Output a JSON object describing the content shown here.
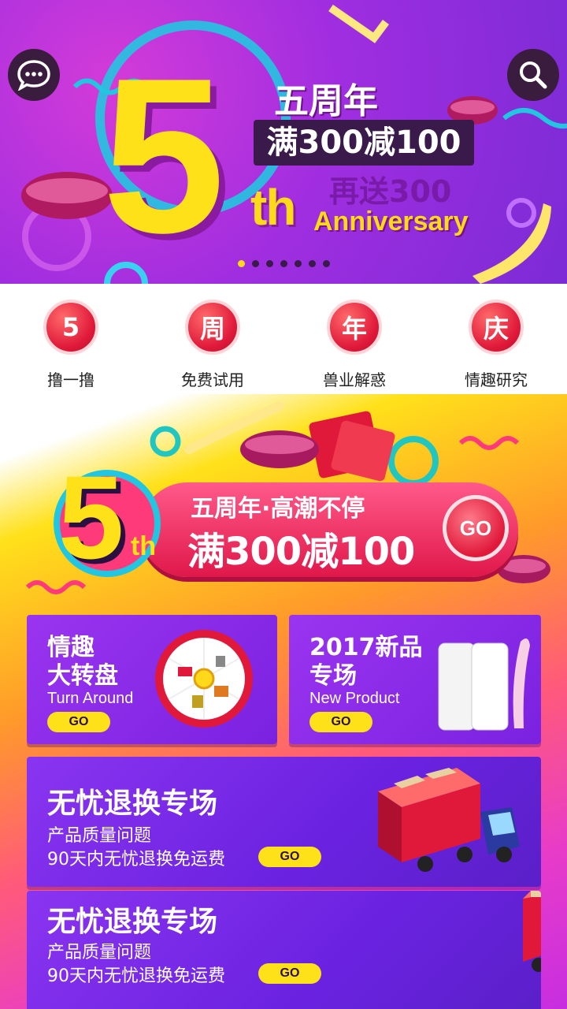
{
  "hero": {
    "big_number": "5",
    "suffix": "th",
    "line1": "五周年",
    "line2": "满300减100",
    "line3": "再送300",
    "line4": "Anniversary",
    "dots_total": 7,
    "dots_active": 0,
    "chat_icon": "chat-bubble-icon",
    "search_icon": "search-icon"
  },
  "quicknav": {
    "items": [
      {
        "icon_text": "5",
        "label": "撸一撸"
      },
      {
        "icon_text": "周",
        "label": "免费试用"
      },
      {
        "icon_text": "年",
        "label": "兽业解惑"
      },
      {
        "icon_text": "庆",
        "label": "情趣研究"
      }
    ]
  },
  "promo": {
    "big_number": "5",
    "suffix": "th",
    "line1": "五周年·高潮不停",
    "line2": "满300减100",
    "go": "GO"
  },
  "cards": {
    "turn": {
      "title1": "情趣",
      "title2": "大转盘",
      "sub": "Turn Around",
      "go": "GO"
    },
    "newp": {
      "title1": "2017新品",
      "title2": "专场",
      "sub": "New Product",
      "go": "GO"
    },
    "return1": {
      "title": "无忧退换专场",
      "line1": "产品质量问题",
      "line2": "90天内无忧退换免运费",
      "go": "GO"
    },
    "return2": {
      "title": "无忧退换专场",
      "line1": "产品质量问题",
      "line2": "90天内无忧退换免运费",
      "go": "GO"
    }
  },
  "colors": {
    "accent_yellow": "#ffd91a",
    "purple": "#7b2bd6",
    "red": "#e0193a"
  }
}
